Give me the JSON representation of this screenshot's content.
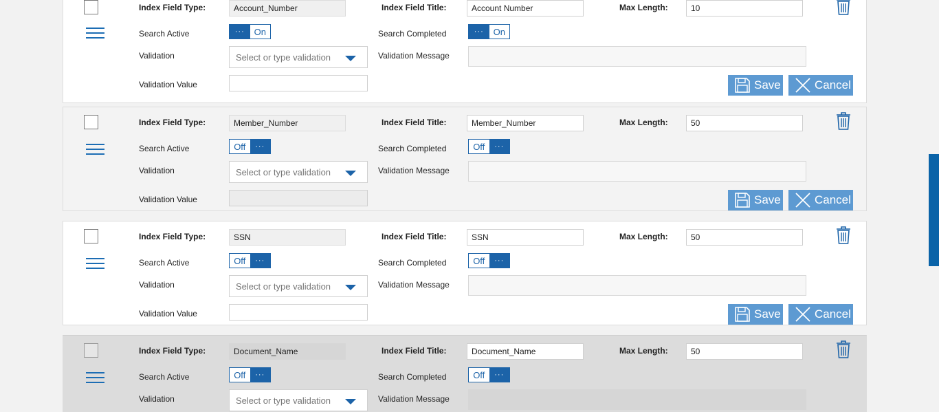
{
  "labels": {
    "index_field_type": "Index Field Type:",
    "index_field_title": "Index Field Title:",
    "max_length": "Max Length:",
    "search_active": "Search Active",
    "search_completed": "Search Completed",
    "validation": "Validation",
    "validation_message": "Validation Message",
    "validation_value": "Validation Value"
  },
  "placeholders": {
    "validation": "Select or type validation"
  },
  "buttons": {
    "save": "Save",
    "cancel": "Cancel"
  },
  "toggle": {
    "on": "On",
    "off": "Off",
    "dots": "···"
  },
  "rows": [
    {
      "index_field_type": "Account_Number",
      "index_field_title": "Account Number",
      "max_length": "10",
      "search_active": "On",
      "search_completed": "On",
      "validation_message": "",
      "validation_value": ""
    },
    {
      "index_field_type": "Member_Number",
      "index_field_title": "Member_Number",
      "max_length": "50",
      "search_active": "Off",
      "search_completed": "Off",
      "validation_message": "",
      "validation_value": ""
    },
    {
      "index_field_type": "SSN",
      "index_field_title": "SSN",
      "max_length": "50",
      "search_active": "Off",
      "search_completed": "Off",
      "validation_message": "",
      "validation_value": ""
    },
    {
      "index_field_type": "Document_Name",
      "index_field_title": "Document_Name",
      "max_length": "50",
      "search_active": "Off",
      "search_completed": "Off",
      "validation_message": ""
    }
  ],
  "colors": {
    "accent": "#1c63a8",
    "button": "#5d9ad2",
    "scrollbar": "#0a63a8"
  }
}
